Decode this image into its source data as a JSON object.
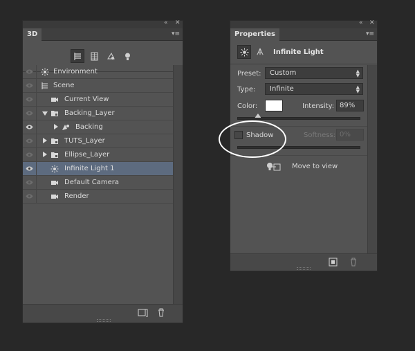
{
  "panel3d": {
    "tab": "3D",
    "collapse": "«",
    "close": "✕",
    "menu": "▾≡",
    "filter_icons": [
      "scene-filter-icon",
      "mesh-filter-icon",
      "material-filter-icon",
      "light-filter-icon"
    ],
    "items": [
      {
        "label": "Environment",
        "icon": "environment-icon",
        "eye": "off"
      },
      {
        "label": "Scene",
        "icon": "scene-icon",
        "eye": "off"
      },
      {
        "label": "Current View",
        "icon": "camera-icon",
        "eye": "off"
      },
      {
        "label": "Backing_Layer",
        "icon": "mesh-icon",
        "eye": "off",
        "expanded": true
      },
      {
        "label": "Backing",
        "icon": "material-icon",
        "eye": "on"
      },
      {
        "label": "TUTS_Layer",
        "icon": "mesh-icon",
        "eye": "off"
      },
      {
        "label": "Ellipse_Layer",
        "icon": "mesh-icon",
        "eye": "off"
      },
      {
        "label": "Infinite Light 1",
        "icon": "infinite-light-icon",
        "eye": "on",
        "selected": true
      },
      {
        "label": "Default Camera",
        "icon": "camera-icon",
        "eye": "off"
      },
      {
        "label": "Render",
        "icon": "render-icon",
        "eye": "off"
      }
    ]
  },
  "properties": {
    "tab": "Properties",
    "collapse": "«",
    "close": "✕",
    "menu": "▾≡",
    "title": "Infinite Light",
    "preset_label": "Preset:",
    "preset_value": "Custom",
    "type_label": "Type:",
    "type_value": "Infinite",
    "color_label": "Color:",
    "color_value": "#ffffff",
    "intensity_label": "Intensity:",
    "intensity_value": "89%",
    "intensity_fraction": 0.16,
    "shadow_label": "Shadow",
    "softness_label": "Softness:",
    "softness_value": "0%",
    "move_to_view": "Move to view"
  }
}
